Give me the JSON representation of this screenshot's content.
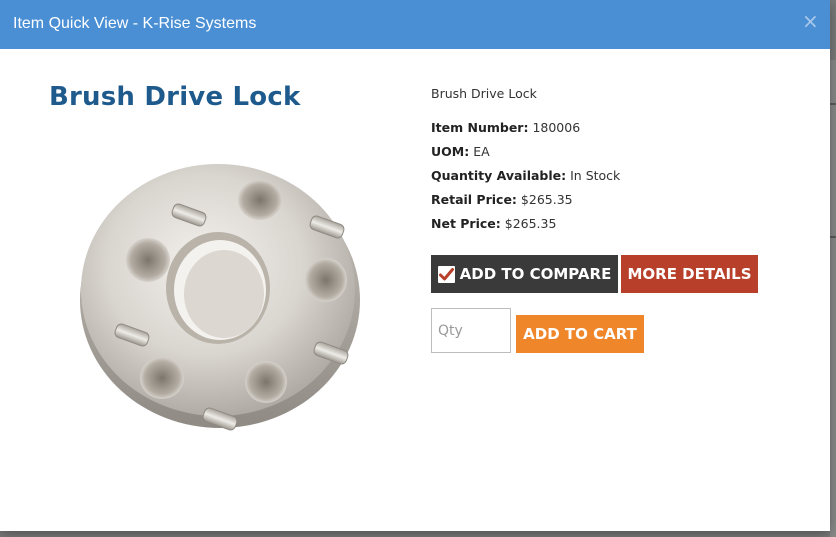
{
  "modal": {
    "title": "Item Quick View - K-Rise Systems",
    "close_label": "×"
  },
  "product": {
    "name": "Brush Drive Lock",
    "description": "Brush Drive Lock",
    "image_icon": "wheel-spacer-image",
    "specs": [
      {
        "label": "Item Number:",
        "value": "180006"
      },
      {
        "label": "UOM:",
        "value": "EA"
      },
      {
        "label": "Quantity Available:",
        "value": "In Stock"
      },
      {
        "label": "Retail Price:",
        "value": "$265.35"
      },
      {
        "label": "Net Price:",
        "value": "$265.35"
      }
    ]
  },
  "actions": {
    "compare_label": "ADD TO COMPARE",
    "details_label": "MORE DETAILS",
    "qty_placeholder": "Qty",
    "qty_value": "",
    "cart_label": "ADD TO CART"
  },
  "colors": {
    "header": "#4a8fd4",
    "title": "#1f5a8c",
    "compare": "#3a3a3a",
    "details": "#b8402a",
    "cart": "#f0862a",
    "check": "#b8402a"
  }
}
